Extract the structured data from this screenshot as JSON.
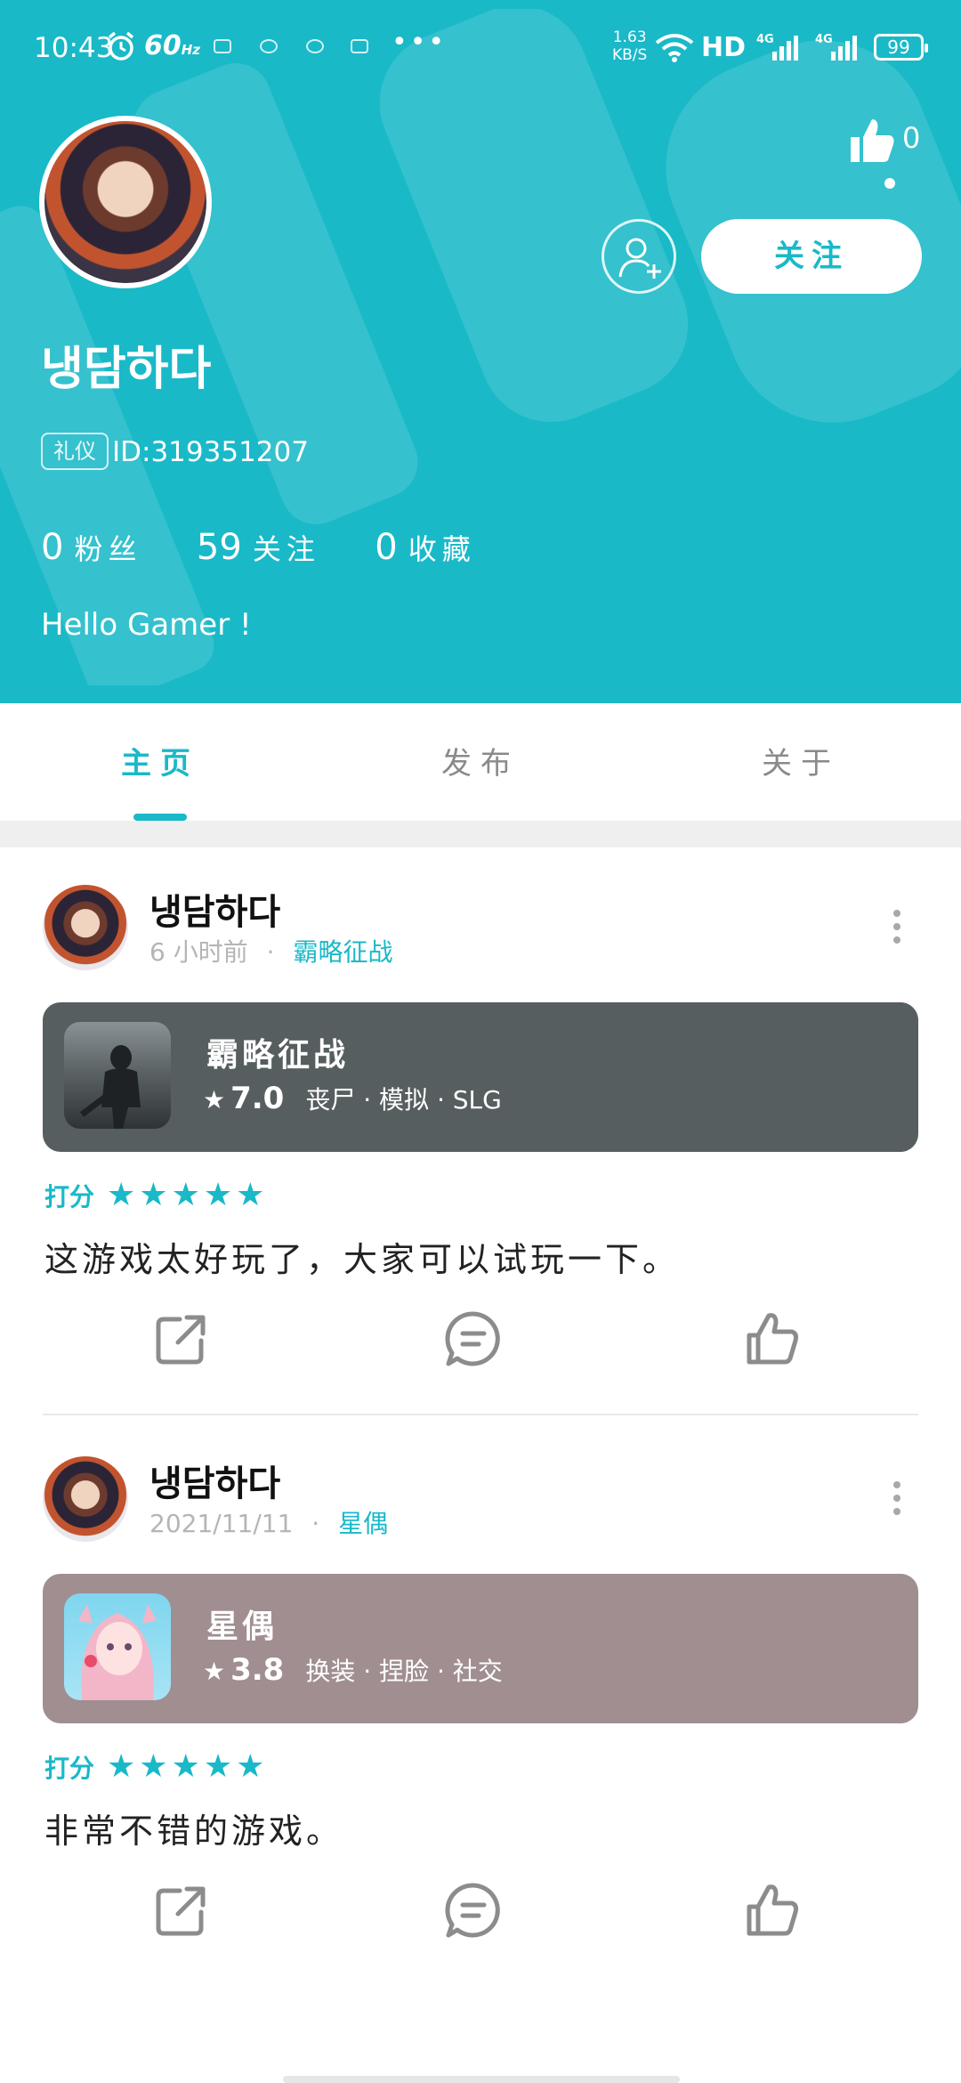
{
  "status_bar": {
    "time": "10:43",
    "refresh": "60",
    "refresh_unit": "Hz",
    "more": "•••",
    "net_speed": "1.63",
    "net_unit": "KB/S",
    "hd": "HD",
    "signal1": "4G",
    "signal2": "4G",
    "battery": "99"
  },
  "profile": {
    "like_count": "0",
    "follow_label": "关注",
    "username": "냉담하다",
    "badge": "礼仪",
    "user_id": "ID:319351207",
    "fans_count": "0",
    "fans_label": "粉丝",
    "following_count": "59",
    "following_label": "关注",
    "fav_count": "0",
    "fav_label": "收藏",
    "bio": "Hello Gamer !"
  },
  "tabs": [
    {
      "label": "主页",
      "active": true
    },
    {
      "label": "发布",
      "active": false
    },
    {
      "label": "关于",
      "active": false
    }
  ],
  "posts": [
    {
      "author": "냉담하다",
      "time": "6 小时前",
      "separator": "·",
      "game_tag": "霸略征战",
      "card_color": "#575e60",
      "game_title": "霸略征战",
      "game_score": "7.0",
      "game_tags": "丧尸 · 模拟 · SLG",
      "rating_label": "打分",
      "stars": "★★★★★",
      "text": "这游戏太好玩了，大家可以试玩一下。"
    },
    {
      "author": "냉담하다",
      "time": "2021/11/11",
      "separator": "·",
      "game_tag": "星偶",
      "card_color": "#a08e91",
      "game_title": "星偶",
      "game_score": "3.8",
      "game_tags": "换装 · 捏脸 · 社交",
      "rating_label": "打分",
      "stars": "★★★★★",
      "text": "非常不错的游戏。"
    }
  ],
  "colors": {
    "accent": "#19b9c8",
    "icon_gray": "#8c8c8c"
  }
}
